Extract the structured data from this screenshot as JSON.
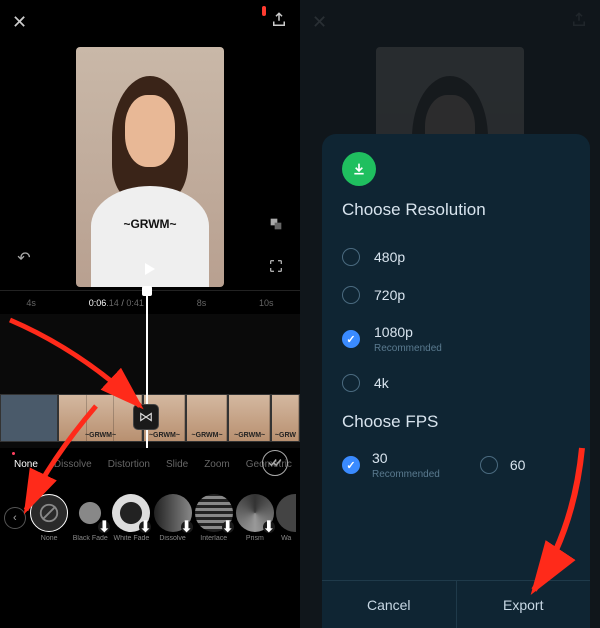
{
  "left": {
    "video_overlay_text": "~GRWM~",
    "timeline": {
      "marks": [
        "4s",
        "8s",
        "10s"
      ],
      "current_time": "0:06",
      "current_frame": "14",
      "total_time": "0:41"
    },
    "clip_labels": [
      "",
      "~GRWM~",
      "~GRWM~",
      "~GRWM~",
      "~GRWM~",
      "~GRW"
    ],
    "categories": [
      "None",
      "Dissolve",
      "Distortion",
      "Slide",
      "Zoom",
      "Geometric"
    ],
    "effects": [
      {
        "label": "None",
        "selected": true,
        "dl": false
      },
      {
        "label": "Black Fade",
        "selected": false,
        "dl": true
      },
      {
        "label": "White Fade",
        "selected": false,
        "dl": true
      },
      {
        "label": "Dissolve",
        "selected": false,
        "dl": true
      },
      {
        "label": "Interlace",
        "selected": false,
        "dl": true
      },
      {
        "label": "Prism",
        "selected": false,
        "dl": true
      },
      {
        "label": "Wa",
        "selected": false,
        "dl": true
      }
    ]
  },
  "right": {
    "title_res": "Choose Resolution",
    "resolutions": [
      {
        "label": "480p",
        "checked": false
      },
      {
        "label": "720p",
        "checked": false
      },
      {
        "label": "1080p",
        "checked": true,
        "sub": "Recommended"
      },
      {
        "label": "4k",
        "checked": false
      }
    ],
    "title_fps": "Choose FPS",
    "fps": [
      {
        "label": "30",
        "checked": true,
        "sub": "Recommended"
      },
      {
        "label": "60",
        "checked": false
      }
    ],
    "cancel": "Cancel",
    "export": "Export"
  }
}
